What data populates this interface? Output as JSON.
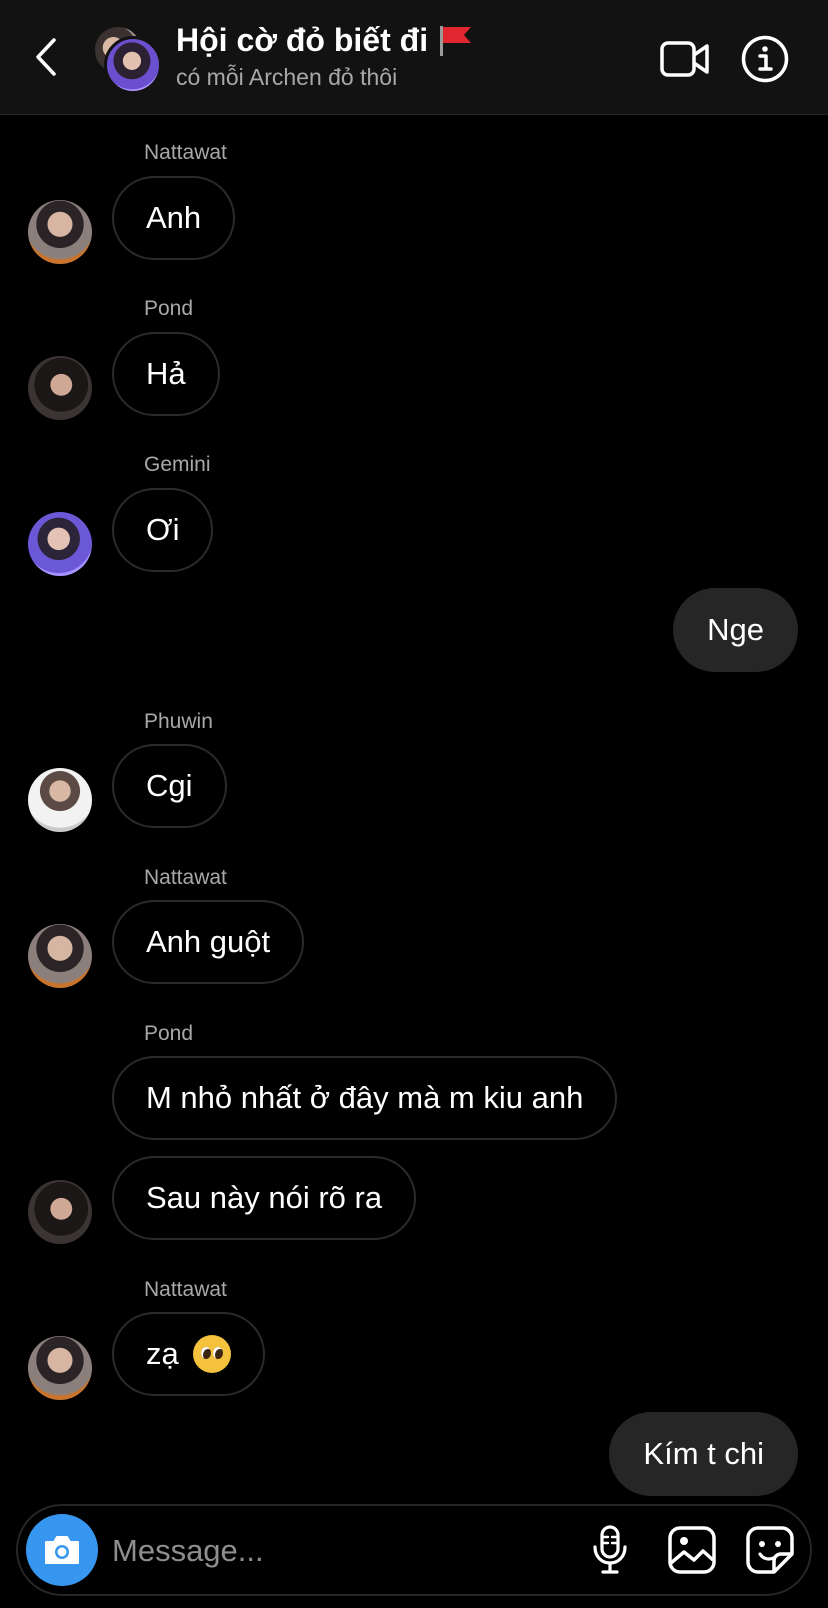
{
  "header": {
    "title": "Hội cờ đỏ biết đi",
    "subtitle": "có mỗi Archen đỏ thôi",
    "icons": {
      "back": "chevron-left-icon",
      "video": "video-camera-icon",
      "info": "info-icon",
      "flag": "red-flag-emoji"
    }
  },
  "messages": [
    {
      "sender": "Nattawat",
      "text": "Anh",
      "direction": "incoming",
      "avatar": "nattawat-avatar"
    },
    {
      "sender": "Pond",
      "text": "Hả",
      "direction": "incoming",
      "avatar": "pond-avatar"
    },
    {
      "sender": "Gemini",
      "text": "Ơi",
      "direction": "incoming",
      "avatar": "gemini-avatar"
    },
    {
      "sender": "",
      "text": "Nge",
      "direction": "outgoing"
    },
    {
      "sender": "Phuwin",
      "text": "Cgi",
      "direction": "incoming",
      "avatar": "phuwin-avatar"
    },
    {
      "sender": "Nattawat",
      "text": "Anh guột",
      "direction": "incoming",
      "avatar": "nattawat-avatar"
    },
    {
      "sender": "Pond",
      "text": "M nhỏ nhất ở đây mà m kiu anh",
      "direction": "incoming"
    },
    {
      "sender": "",
      "text": "Sau này nói rõ ra",
      "direction": "incoming",
      "avatar": "pond-avatar"
    },
    {
      "sender": "Nattawat",
      "text": "zạ",
      "emoji": "pleading-face-emoji",
      "direction": "incoming",
      "avatar": "nattawat-avatar"
    },
    {
      "sender": "",
      "text": "Kím t chi",
      "direction": "outgoing"
    }
  ],
  "composer": {
    "placeholder": "Message...",
    "icons": {
      "camera": "camera-icon",
      "mic": "microphone-icon",
      "gallery": "image-icon",
      "sticker": "sticker-icon"
    }
  },
  "colors": {
    "background": "#000000",
    "header": "#121212",
    "outgoing_bubble": "#262626",
    "incoming_border": "#2a2a2a",
    "accent": "#3797f0",
    "secondary_text": "#a8a8a8"
  }
}
